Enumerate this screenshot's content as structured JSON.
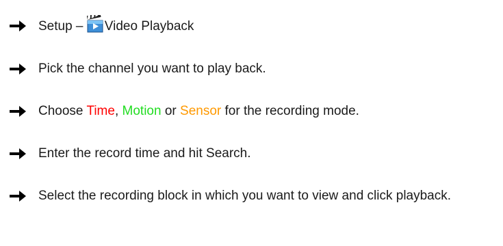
{
  "steps": [
    {
      "icon": "right-arrow-icon",
      "prefix": "Setup – ",
      "inline_icon": "video-playback-icon",
      "label": "Video Playback"
    },
    {
      "icon": "right-arrow-icon",
      "text": "Pick the channel you want to play back."
    },
    {
      "icon": "right-arrow-icon",
      "prefix": "Choose ",
      "time": "Time",
      "sep1": ", ",
      "motion": "Motion",
      "sep2": " or ",
      "sensor": "Sensor",
      "suffix": " for the recording mode."
    },
    {
      "icon": "right-arrow-icon",
      "text": "Enter the record time and hit Search."
    },
    {
      "icon": "right-arrow-icon",
      "text": "Select the recording block in which you want to view and click playback."
    }
  ],
  "colors": {
    "time": "#ff0000",
    "motion": "#22dd22",
    "sensor": "#ff9900"
  }
}
